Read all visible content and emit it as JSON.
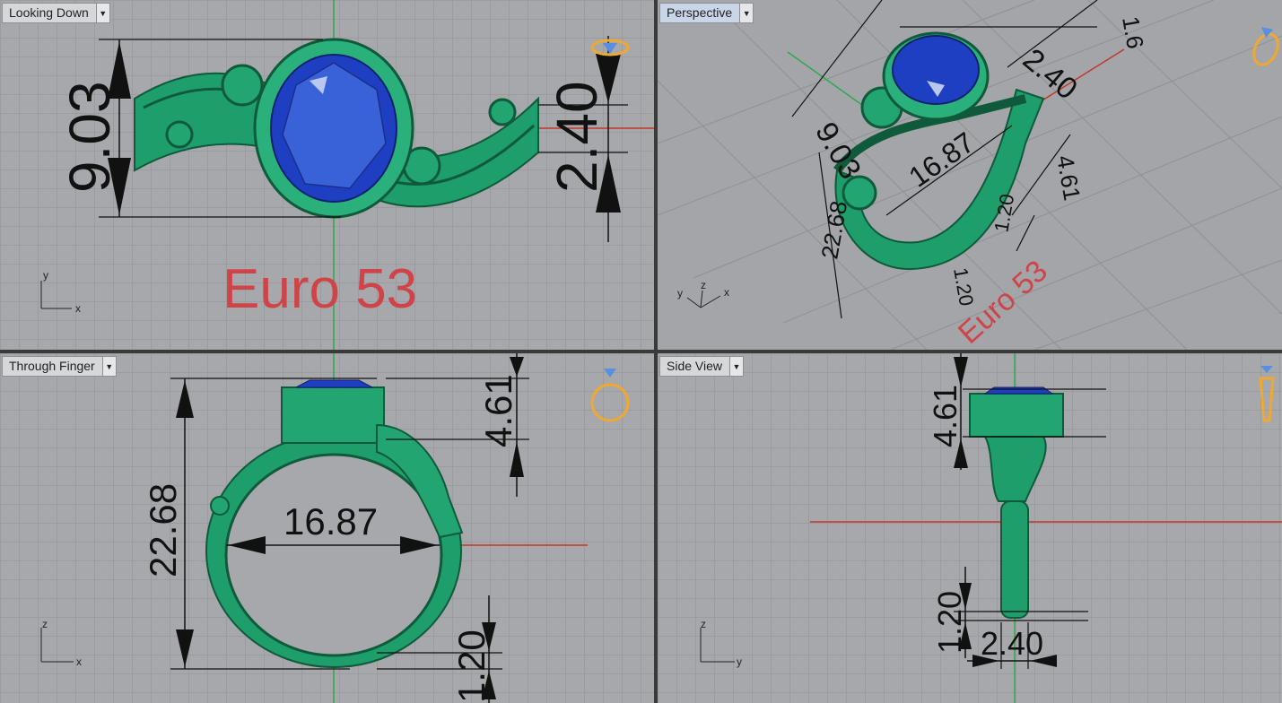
{
  "viewports": {
    "top": {
      "label": "Looking Down",
      "menu_icon": "dropdown-arrow-icon",
      "axis_x": "x",
      "axis_y": "y"
    },
    "persp": {
      "label": "Perspective",
      "menu_icon": "dropdown-arrow-icon",
      "axis_x": "x",
      "axis_y": "y",
      "axis_z": "z"
    },
    "front": {
      "label": "Through Finger",
      "menu_icon": "dropdown-arrow-icon",
      "axis_x": "x",
      "axis_z": "z"
    },
    "right": {
      "label": "Side View",
      "menu_icon": "dropdown-arrow-icon",
      "axis_y": "y",
      "axis_z": "z"
    }
  },
  "annotations": {
    "size_label": "Euro 53",
    "top": {
      "width": "9.03",
      "shank": "2.40"
    },
    "persp": {
      "d1": "9.03",
      "d2": "2.40",
      "d3": "16.87",
      "d4": "4.61",
      "d5": "22.68",
      "d6": "1.20",
      "d7": "2.40",
      "d8": "1.20",
      "d9": "1.20",
      "d10": "1.6"
    },
    "front": {
      "outer": "22.68",
      "inner": "16.87",
      "head": "4.61",
      "band": "1.20"
    },
    "right": {
      "head": "4.61",
      "band": "1.20",
      "width": "2.40"
    }
  },
  "colors": {
    "metal": "#1e9e6a",
    "stone": "#1f3fc2",
    "size_text": "#cf4448",
    "view_icon": "#f0a830"
  }
}
